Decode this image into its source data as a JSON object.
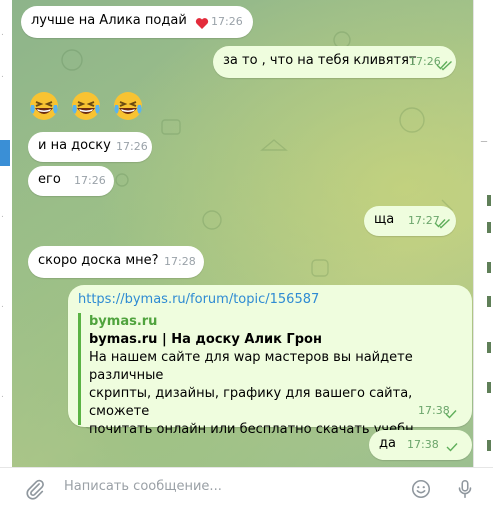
{
  "colors": {
    "outgoing_bubble": "#effdde",
    "incoming_bubble": "#ffffff",
    "link": "#2f8bd3",
    "preview_accent": "#5bb344",
    "read_checks": "#5fae5b"
  },
  "messages": [
    {
      "direction": "in",
      "text": "лучше на Алика подай",
      "time": "17:26",
      "reaction": "heart-icon"
    },
    {
      "direction": "out",
      "text": "за то , что на тебя кливятят",
      "time": "17:26",
      "status": "read"
    },
    {
      "direction": "in",
      "emoji": [
        "grinning-squinting-tears-emoji",
        "grinning-squinting-tears-emoji",
        "grinning-squinting-tears-emoji"
      ]
    },
    {
      "direction": "in",
      "text": "и на доску",
      "time": "17:26"
    },
    {
      "direction": "in",
      "text": "его",
      "time": "17:26"
    },
    {
      "direction": "out",
      "text": "ща",
      "time": "17:27",
      "status": "read"
    },
    {
      "direction": "in",
      "text": "скоро доска мне?",
      "time": "17:28"
    },
    {
      "direction": "out",
      "link": "https://bymas.ru/forum/topic/156587",
      "preview": {
        "site": "bymas.ru",
        "title": "bymas.ru | На доску Алик Грон",
        "description_lines": [
          "На нашем сайте для wap мастеров вы найдете различные",
          "скрипты, дизайны, графику для вашего сайта, сможете",
          "почитать онлайн или бесплатно скачать учебн..."
        ]
      },
      "time": "17:38",
      "status": "sent"
    },
    {
      "direction": "out",
      "text": "да",
      "time": "17:38",
      "status": "sent"
    }
  ],
  "composer": {
    "placeholder": "Написать сообщение...",
    "icons": [
      "paperclip-icon",
      "emoji-icon",
      "microphone-icon"
    ]
  }
}
